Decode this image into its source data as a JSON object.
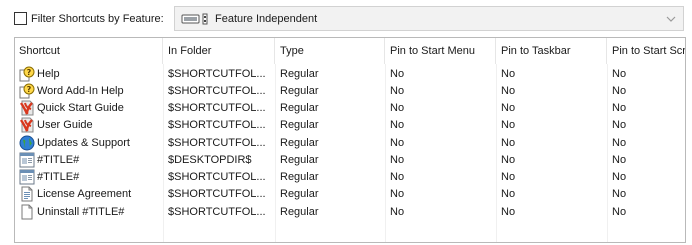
{
  "filter": {
    "checkbox_label": "Filter Shortcuts by Feature:",
    "checked": false,
    "selected_feature": "Feature Independent"
  },
  "columns": [
    "Shortcut",
    "In Folder",
    "Type",
    "Pin to Start Menu",
    "Pin to Taskbar",
    "Pin to Start Scr"
  ],
  "rows": [
    {
      "icon": "help-icon",
      "shortcut": "Help",
      "folder": "$SHORTCUTFOL...",
      "type": "Regular",
      "pin_start": "No",
      "pin_taskbar": "No",
      "pin_start_screen": "No"
    },
    {
      "icon": "help-icon",
      "shortcut": "Word Add-In Help",
      "folder": "$SHORTCUTFOL...",
      "type": "Regular",
      "pin_start": "No",
      "pin_taskbar": "No",
      "pin_start_screen": "No"
    },
    {
      "icon": "pdf-icon",
      "shortcut": "Quick Start Guide",
      "folder": "$SHORTCUTFOL...",
      "type": "Regular",
      "pin_start": "No",
      "pin_taskbar": "No",
      "pin_start_screen": "No"
    },
    {
      "icon": "pdf-icon",
      "shortcut": "User Guide",
      "folder": "$SHORTCUTFOL...",
      "type": "Regular",
      "pin_start": "No",
      "pin_taskbar": "No",
      "pin_start_screen": "No"
    },
    {
      "icon": "globe-icon",
      "shortcut": "Updates & Support",
      "folder": "$SHORTCUTFOL...",
      "type": "Regular",
      "pin_start": "No",
      "pin_taskbar": "No",
      "pin_start_screen": "No"
    },
    {
      "icon": "app-window-icon",
      "shortcut": "#TITLE#",
      "folder": "$DESKTOPDIR$",
      "type": "Regular",
      "pin_start": "No",
      "pin_taskbar": "No",
      "pin_start_screen": "No"
    },
    {
      "icon": "app-window-icon",
      "shortcut": "#TITLE#",
      "folder": "$SHORTCUTFOL...",
      "type": "Regular",
      "pin_start": "No",
      "pin_taskbar": "No",
      "pin_start_screen": "No"
    },
    {
      "icon": "document-icon",
      "shortcut": "License Agreement",
      "folder": "$SHORTCUTFOL...",
      "type": "Regular",
      "pin_start": "No",
      "pin_taskbar": "No",
      "pin_start_screen": "No"
    },
    {
      "icon": "blank-file-icon",
      "shortcut": "Uninstall #TITLE#",
      "folder": "$SHORTCUTFOL...",
      "type": "Regular",
      "pin_start": "No",
      "pin_taskbar": "No",
      "pin_start_screen": "No"
    }
  ]
}
